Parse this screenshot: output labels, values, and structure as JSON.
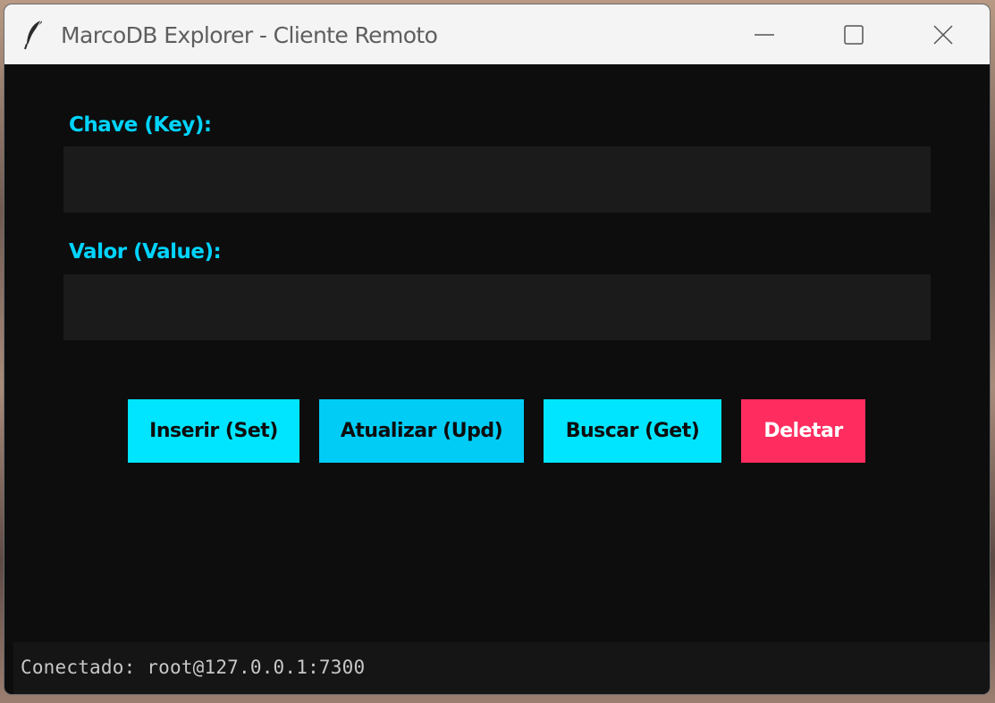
{
  "window": {
    "title": "MarcoDB Explorer - Cliente Remoto",
    "icon": "feather-icon",
    "controls": [
      "minimize-icon",
      "maximize-icon",
      "close-icon"
    ]
  },
  "form": {
    "key_label": "Chave (Key):",
    "key_value": "",
    "value_label": "Valor (Value):",
    "value_value": ""
  },
  "actions": {
    "set_label": "Inserir (Set)",
    "update_label": "Atualizar (Upd)",
    "get_label": "Buscar (Get)",
    "delete_label": "Deletar"
  },
  "status": {
    "text": "Conectado: root@127.0.0.1:7300"
  },
  "colors": {
    "accent": "#00e5ff",
    "accent_alt": "#00ccf5",
    "danger": "#ff2d5f",
    "background": "#0d0d0d",
    "field": "#1b1b1b"
  }
}
